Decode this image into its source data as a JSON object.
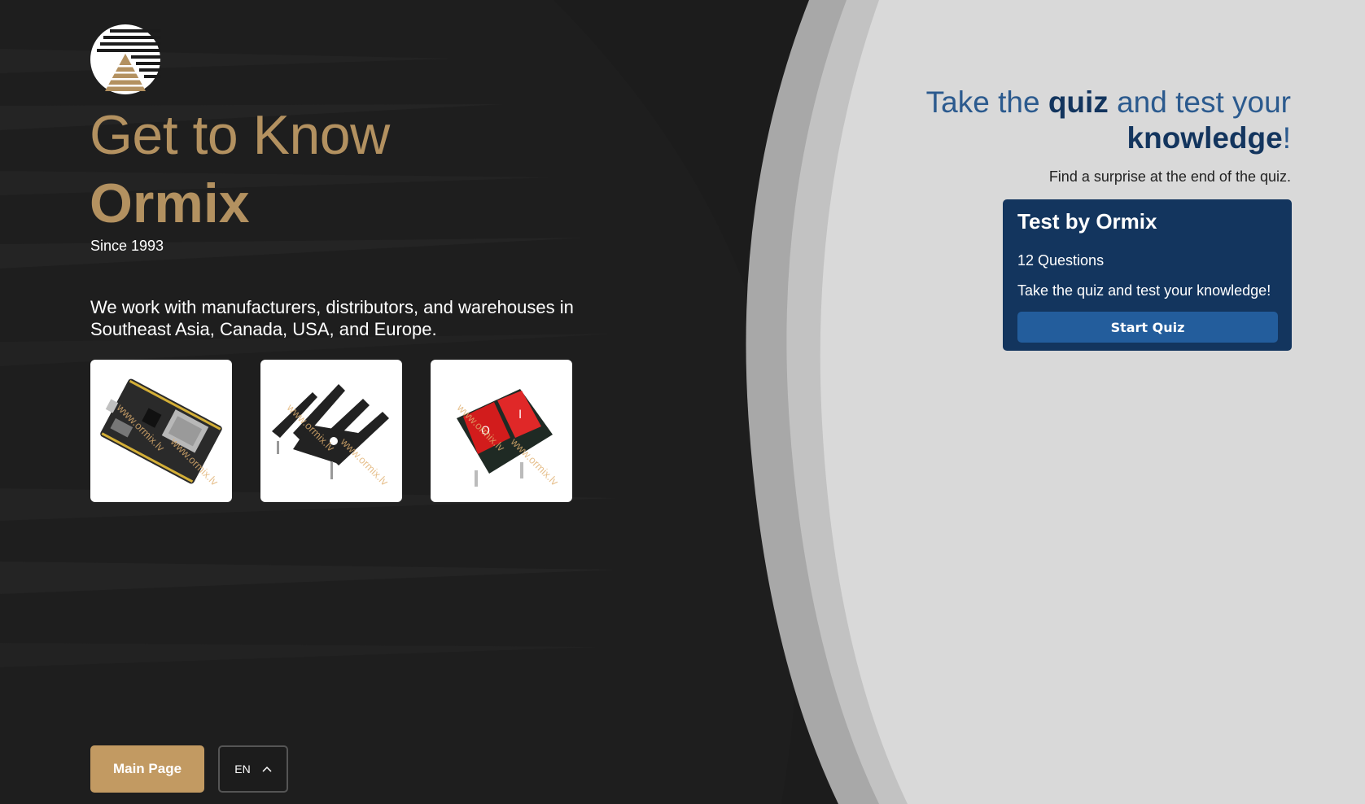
{
  "hero": {
    "title_line1": "Get to Know",
    "title_line2": "Ormix",
    "since": "Since 1993",
    "intro": "We work with manufacturers, distributors, and warehouses in Southeast Asia, Canada, USA, and Europe."
  },
  "products": [
    {
      "name": "esp8266-dev-board",
      "watermark": "www.ormix.lv"
    },
    {
      "name": "heatsink",
      "watermark": "www.ormix.lv"
    },
    {
      "name": "rocker-switch",
      "watermark": "www.ormix.lv"
    }
  ],
  "footer": {
    "main_page_label": "Main Page",
    "language": "EN"
  },
  "quiz": {
    "heading_pre": "Take the ",
    "heading_bold1": "quiz",
    "heading_mid": " and test your ",
    "heading_bold2": "knowledge",
    "heading_end": "!",
    "subtitle": "Find a surprise at the end of the quiz.",
    "card_title": "Test by Ormix",
    "question_count": "12 Questions",
    "card_description": "Take the quiz and test your knowledge!",
    "start_label": "Start Quiz"
  },
  "colors": {
    "gold": "#b39160",
    "button_gold": "#c29a62",
    "navy": "#13355e",
    "blue": "#235d9c",
    "panel_grey": "#d9d9d9",
    "dark_bg": "#1c1c1c"
  }
}
